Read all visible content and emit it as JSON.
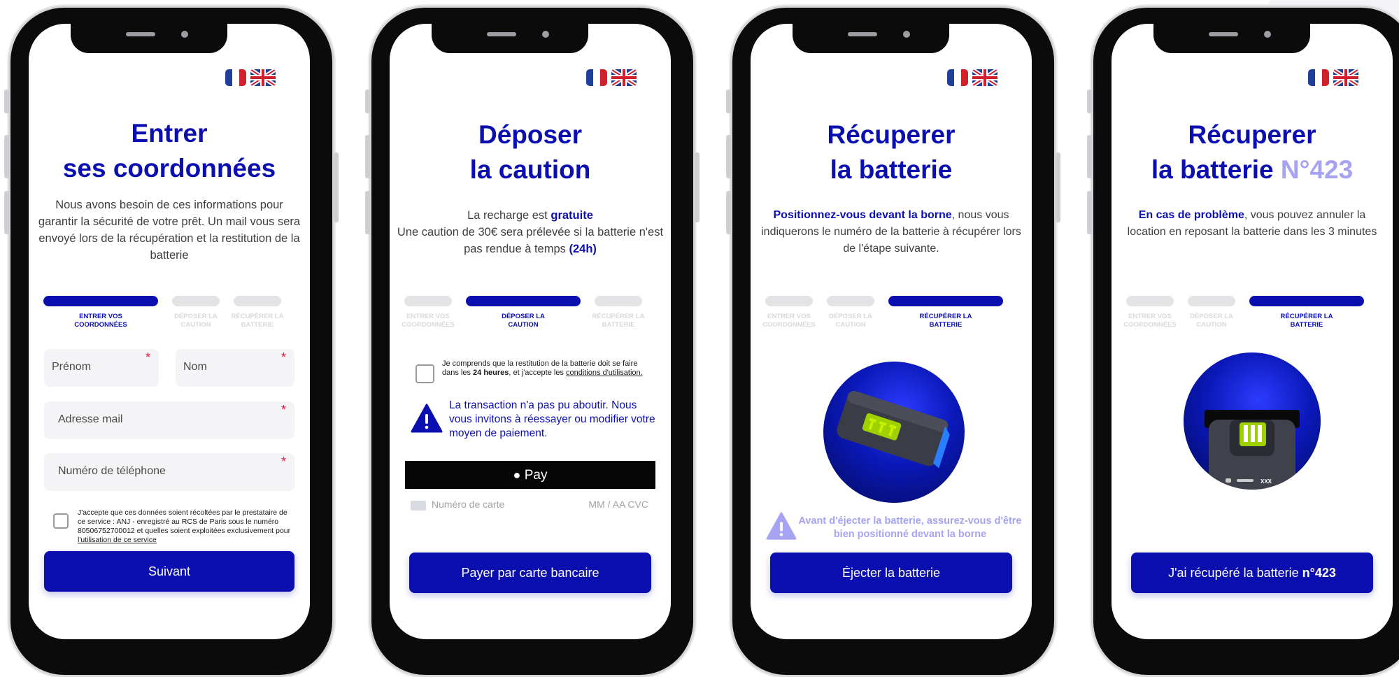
{
  "flags": {
    "fr": "French flag",
    "uk": "UK flag"
  },
  "colors": {
    "primary": "#0b0fb0",
    "accent": "#a7a3f3",
    "required": "#e3173e",
    "inactive": "#e3e3e6"
  },
  "steps": {
    "step1": "ENTRER VOS COORDONNÉES",
    "step2": "DÉPOSER LA CAUTION",
    "step3": "RÉCUPÉRER LA BATTERIE"
  },
  "screen1": {
    "title_line1": "Entrer",
    "title_line2": "ses coordonnées",
    "intro": "Nous avons besoin de ces informations pour garantir la sécurité de votre prêt. Un mail vous sera envoyé lors de la récupération et la restitution de la batterie",
    "active_step": 1,
    "fields": {
      "firstname": "Prénom",
      "lastname": "Nom",
      "email": "Adresse mail",
      "phone": "Numéro de téléphone",
      "required_mark": "*"
    },
    "consent_text": "J'accepte que ces données soient récoltées par le prestataire de ce service : ANJ - enregistré au RCS de Paris sous le numéro 80506752700012 et quelles soient exploitées exclusivement pour ",
    "consent_link": "l'utilisation de ce service",
    "button": "Suivant"
  },
  "screen2": {
    "title_line1": "Déposer",
    "title_line2": "la caution",
    "intro_a": "La recharge est ",
    "intro_a_bold": "gratuite",
    "intro_b": "Une caution de 30€  sera prélevée si la batterie n'est pas rendue à temps ",
    "intro_b_bold": "(24h)",
    "active_step": 2,
    "terms_a": "Je comprends que la restitution de la batterie doit se faire dans les ",
    "terms_bold": "24 heures",
    "terms_b": ", et j'accepte les ",
    "terms_link": "conditions d'utilisation.",
    "error": "La transaction n'a pas pu aboutir. Nous vous invitons à réessayer ou modifier votre moyen de paiement.",
    "apple_pay": "Pay",
    "card_placeholder": "Numéro de carte",
    "card_expiry": "MM / AA  CVC",
    "button": "Payer par carte bancaire"
  },
  "screen3": {
    "title_line1": "Récuperer",
    "title_line2": "la  batterie",
    "intro_bold": "Positionnez-vous devant la borne",
    "intro": ", nous vous indiquerons le numéro de la batterie à récupérer lors de l'étape suivante.",
    "active_step": 3,
    "warning": "Avant d'éjecter la batterie, assurez-vous d'être bien positionné devant la borne",
    "button": "Éjecter la batterie"
  },
  "screen4": {
    "title_line1": "Récuperer",
    "title_line2a": "la  batterie ",
    "title_line2b": "N°423",
    "intro_bold": "En cas de problème",
    "intro": ", vous pouvez annuler la location en reposant la batterie dans les 3 minutes",
    "active_step": 3,
    "battery_label": "XXX",
    "button_a": "J'ai récupéré la batterie ",
    "button_b": "n°423"
  }
}
